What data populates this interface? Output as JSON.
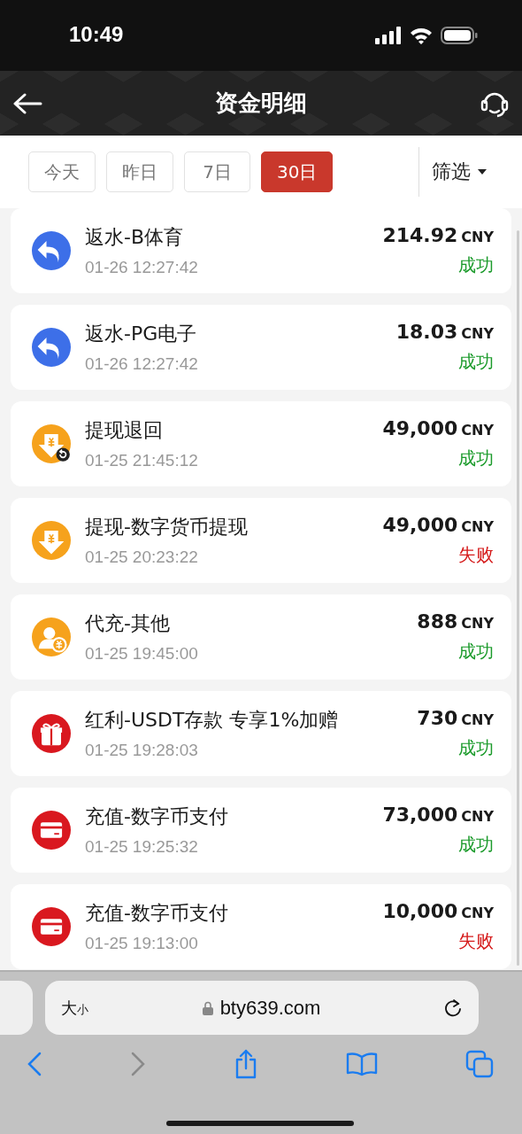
{
  "status_bar": {
    "time": "10:49"
  },
  "header": {
    "title": "资金明细"
  },
  "date_tabs": [
    {
      "label": "今天",
      "selected": false
    },
    {
      "label": "昨日",
      "selected": false
    },
    {
      "label": "7日",
      "selected": false
    },
    {
      "label": "30日",
      "selected": true
    }
  ],
  "filter": {
    "label": "筛选"
  },
  "records": [
    {
      "kind": "rebate",
      "title": "返水-B体育",
      "time": "01-26 12:27:42",
      "amount": "214.92",
      "currency": "CNY",
      "status": "成功",
      "color": "#1a9a2a"
    },
    {
      "kind": "rebate",
      "title": "返水-PG电子",
      "time": "01-26 12:27:42",
      "amount": "18.03",
      "currency": "CNY",
      "status": "成功",
      "color": "#1a9a2a"
    },
    {
      "kind": "withdrawreturn",
      "title": "提现退回",
      "time": "01-25 21:45:12",
      "amount": "49,000",
      "currency": "CNY",
      "status": "成功",
      "color": "#1a9a2a"
    },
    {
      "kind": "withdraw",
      "title": "提现-数字货币提现",
      "time": "01-25 20:23:22",
      "amount": "49,000",
      "currency": "CNY",
      "status": "失败",
      "color": "#d51a1a"
    },
    {
      "kind": "agent",
      "title": "代充-其他",
      "time": "01-25 19:45:00",
      "amount": "888",
      "currency": "CNY",
      "status": "成功",
      "color": "#1a9a2a"
    },
    {
      "kind": "gift",
      "title": "红利-USDT存款 专享1%加赠",
      "time": "01-25 19:28:03",
      "amount": "730",
      "currency": "CNY",
      "status": "成功",
      "color": "#1a9a2a"
    },
    {
      "kind": "deposit",
      "title": "充值-数字币支付",
      "time": "01-25 19:25:32",
      "amount": "73,000",
      "currency": "CNY",
      "status": "成功",
      "color": "#1a9a2a"
    },
    {
      "kind": "deposit",
      "title": "充值-数字币支付",
      "time": "01-25 19:13:00",
      "amount": "10,000",
      "currency": "CNY",
      "status": "失败",
      "color": "#d51a1a"
    }
  ],
  "browser": {
    "reader_button": [
      "大",
      "小"
    ],
    "url": "bty639.com"
  }
}
